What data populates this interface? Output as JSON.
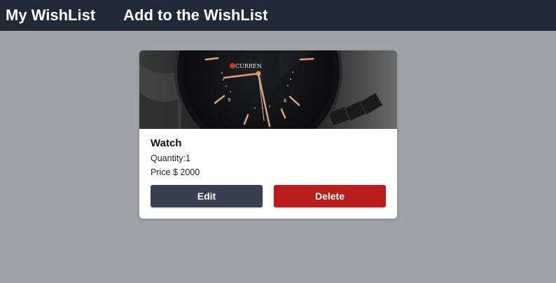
{
  "navbar": {
    "links": [
      {
        "label": "My WishList"
      },
      {
        "label": "Add to the WishList"
      }
    ],
    "background_color": "#1f2937"
  },
  "item": {
    "name": "Watch",
    "quantity_text": "Quantity:1",
    "price_text": "Price $ 2000",
    "image_subject": "wristwatch",
    "brand_mark": "CURREN"
  },
  "actions": {
    "edit_label": "Edit",
    "delete_label": "Delete",
    "edit_color": "#374151",
    "delete_color": "#b91c1c"
  },
  "page_background": "#a1a1a8"
}
